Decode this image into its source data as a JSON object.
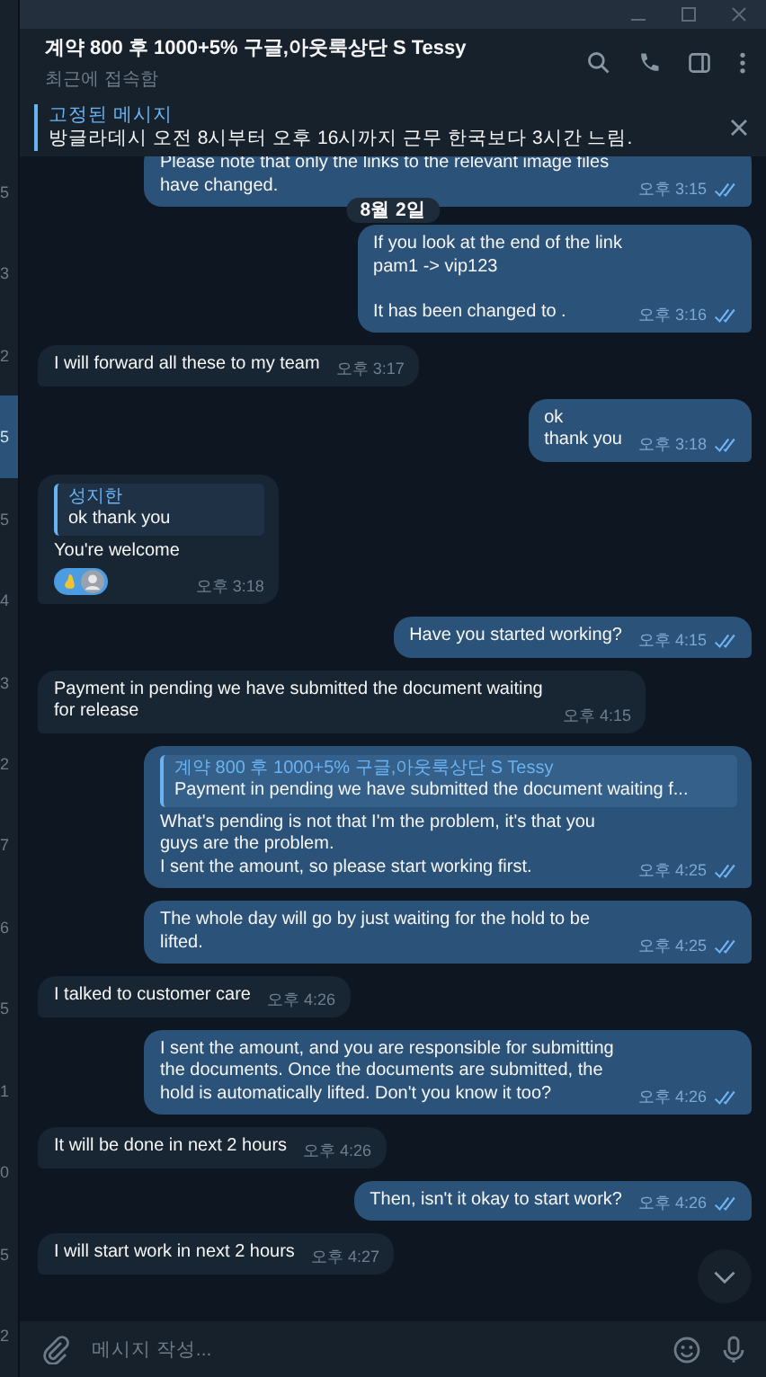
{
  "chat_list_edge": [
    {
      "text": "5",
      "selected": false
    },
    {
      "text": "3",
      "selected": false
    },
    {
      "text": "2",
      "selected": false
    },
    {
      "text": "5",
      "selected": true
    },
    {
      "text": "5",
      "selected": false
    },
    {
      "text": "4",
      "selected": false
    },
    {
      "text": "3",
      "selected": false
    },
    {
      "text": "2",
      "selected": false
    },
    {
      "text": "7",
      "selected": false
    },
    {
      "text": "6",
      "selected": false
    },
    {
      "text": "5",
      "selected": false
    },
    {
      "text": "1",
      "selected": false
    },
    {
      "text": "0",
      "selected": false
    },
    {
      "text": "5",
      "selected": false
    },
    {
      "text": "2",
      "selected": false
    }
  ],
  "header": {
    "title": "계약 800 후 1000+5% 구글,아웃룩상단 S Tessy",
    "status": "최근에 접속함"
  },
  "pinned": {
    "label": "고정된 메시지",
    "text": "방글라데시  오전 8시부터 오후 16시까지 근무 한국보다 3시간 느림."
  },
  "date_badge": "8월 2일",
  "messages": [
    {
      "kind": "out",
      "text": "Please note that only the links to the relevant image files have changed.",
      "time": "오후 3:15",
      "read": true
    },
    {
      "kind": "out",
      "text": "If you look at the end of the link\npam1 -> vip123\n\nIt has been changed to .",
      "time": "오후 3:16",
      "read": true
    },
    {
      "kind": "in",
      "text": "I will forward all these to my team",
      "time": "오후 3:17"
    },
    {
      "kind": "out",
      "text": "ok\nthank you",
      "time": "오후 3:18",
      "read": true
    },
    {
      "kind": "in",
      "reply": {
        "author": "성지한",
        "text": "ok thank you"
      },
      "text": "You're welcome",
      "reaction": true,
      "time": "오후 3:18"
    },
    {
      "kind": "out",
      "text": "Have you started working?",
      "time": "오후 4:15",
      "read": true
    },
    {
      "kind": "in",
      "text": "Payment in pending we have submitted the document waiting for release",
      "time": "오후 4:15"
    },
    {
      "kind": "out",
      "reply": {
        "author": "계약 800 후 1000+5% 구글,아웃룩상단 S Tessy",
        "text": "Payment in pending we have submitted the document waiting f..."
      },
      "text": "What's pending is not that I'm the problem, it's that you guys are the problem.\nI sent the amount, so please start working first.",
      "time": "오후 4:25",
      "read": true
    },
    {
      "kind": "out",
      "text": "The whole day will go by just waiting for the hold to be lifted.",
      "time": "오후 4:25",
      "read": true
    },
    {
      "kind": "in",
      "text": "I talked to customer care",
      "time": "오후 4:26"
    },
    {
      "kind": "out",
      "text": "I sent the amount, and you are responsible for submitting the documents. Once the documents are submitted, the hold is automatically lifted. Don't you know it too?",
      "time": "오후 4:26",
      "read": true
    },
    {
      "kind": "in",
      "text": "It will be done in next 2 hours",
      "time": "오후 4:26"
    },
    {
      "kind": "out",
      "text": "Then, isn't it okay to start work?",
      "time": "오후 4:26",
      "read": true
    },
    {
      "kind": "in",
      "text": "I will start work in next 2 hours",
      "time": "오후 4:27"
    }
  ],
  "composer": {
    "placeholder": "메시지 작성..."
  }
}
